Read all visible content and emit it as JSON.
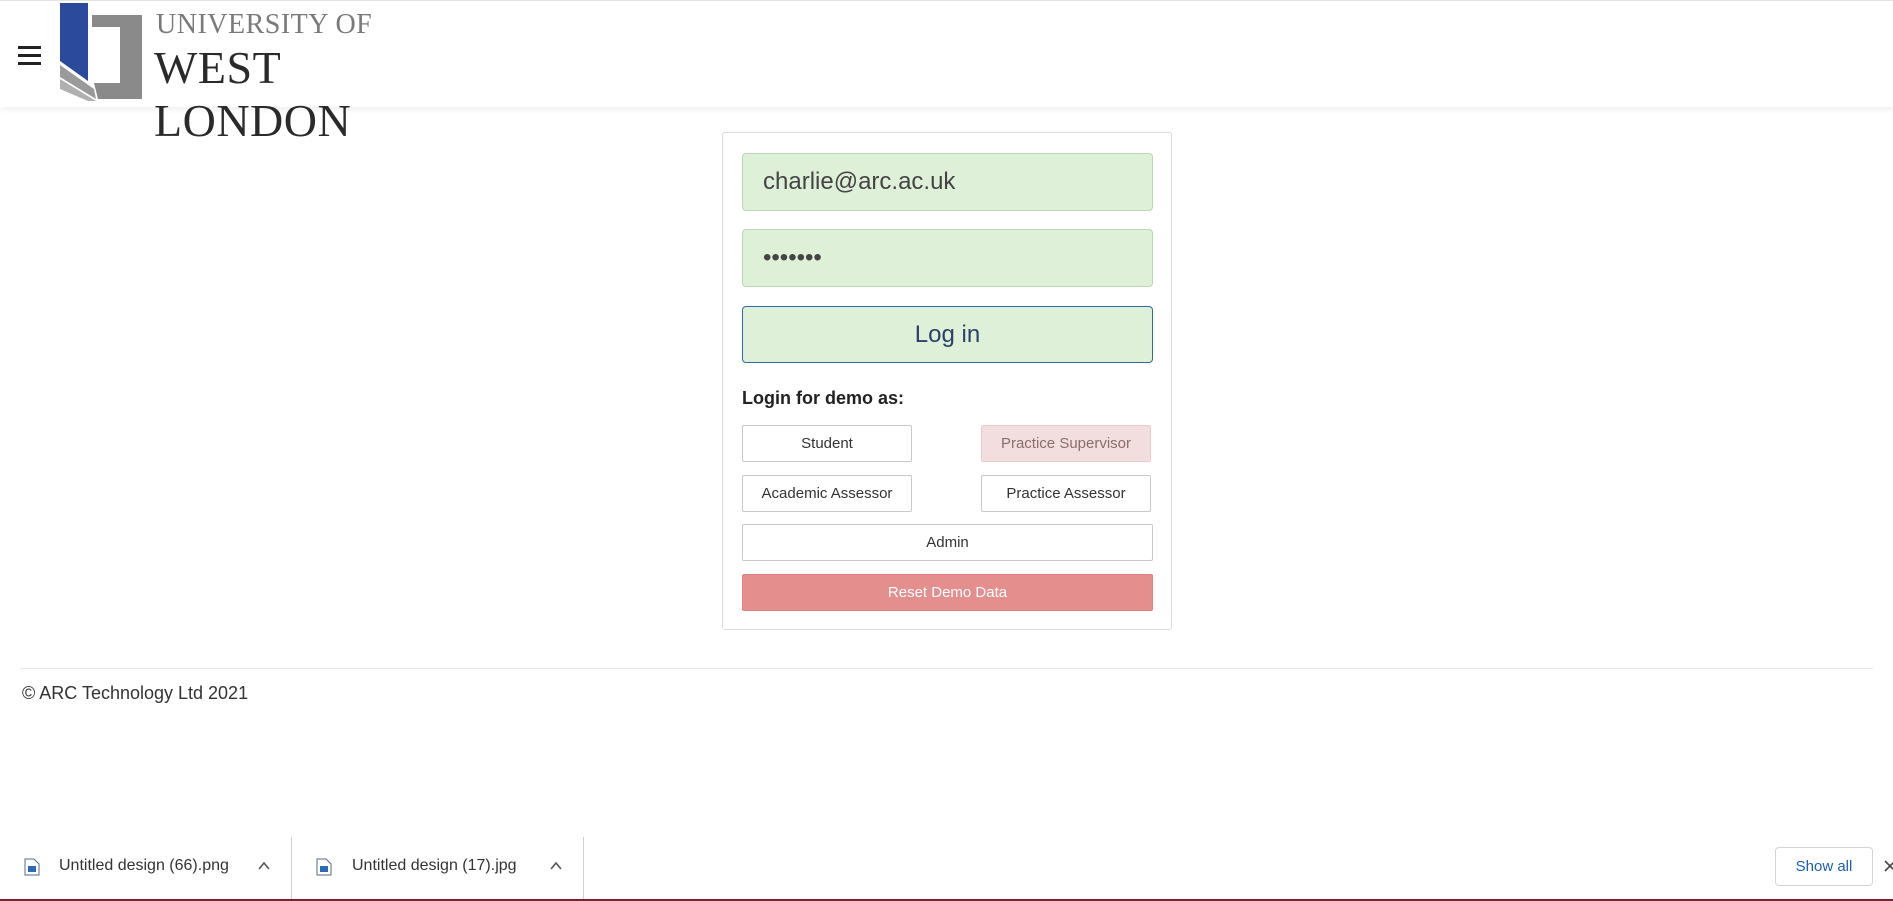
{
  "header": {
    "logo_line1": "UNIVERSITY OF",
    "logo_line2": "WEST LONDON"
  },
  "login": {
    "email_value": "charlie@arc.ac.uk",
    "password_value": "•••••••",
    "login_label": "Log in",
    "demo_heading": "Login for demo as:",
    "demo_buttons": {
      "student": "Student",
      "practice_supervisor": "Practice Supervisor",
      "academic_assessor": "Academic Assessor",
      "practice_assessor": "Practice Assessor",
      "admin": "Admin"
    },
    "reset_label": "Reset Demo Data"
  },
  "footer": {
    "copyright": "© ARC Technology Ltd 2021"
  },
  "downloads": {
    "items": [
      {
        "name": "Untitled design (66).png",
        "icon": "image-file-icon"
      },
      {
        "name": "Untitled design (17).jpg",
        "icon": "image-file-icon"
      }
    ],
    "show_all_label": "Show all"
  },
  "colors": {
    "field_bg": "#dff0d8",
    "login_border": "#2e6da4",
    "reset_bg": "#e58e8e",
    "practice_supervisor_bg": "#f2dede",
    "logo_blue": "#2b4a9b",
    "logo_grey": "#8a8a8a"
  }
}
